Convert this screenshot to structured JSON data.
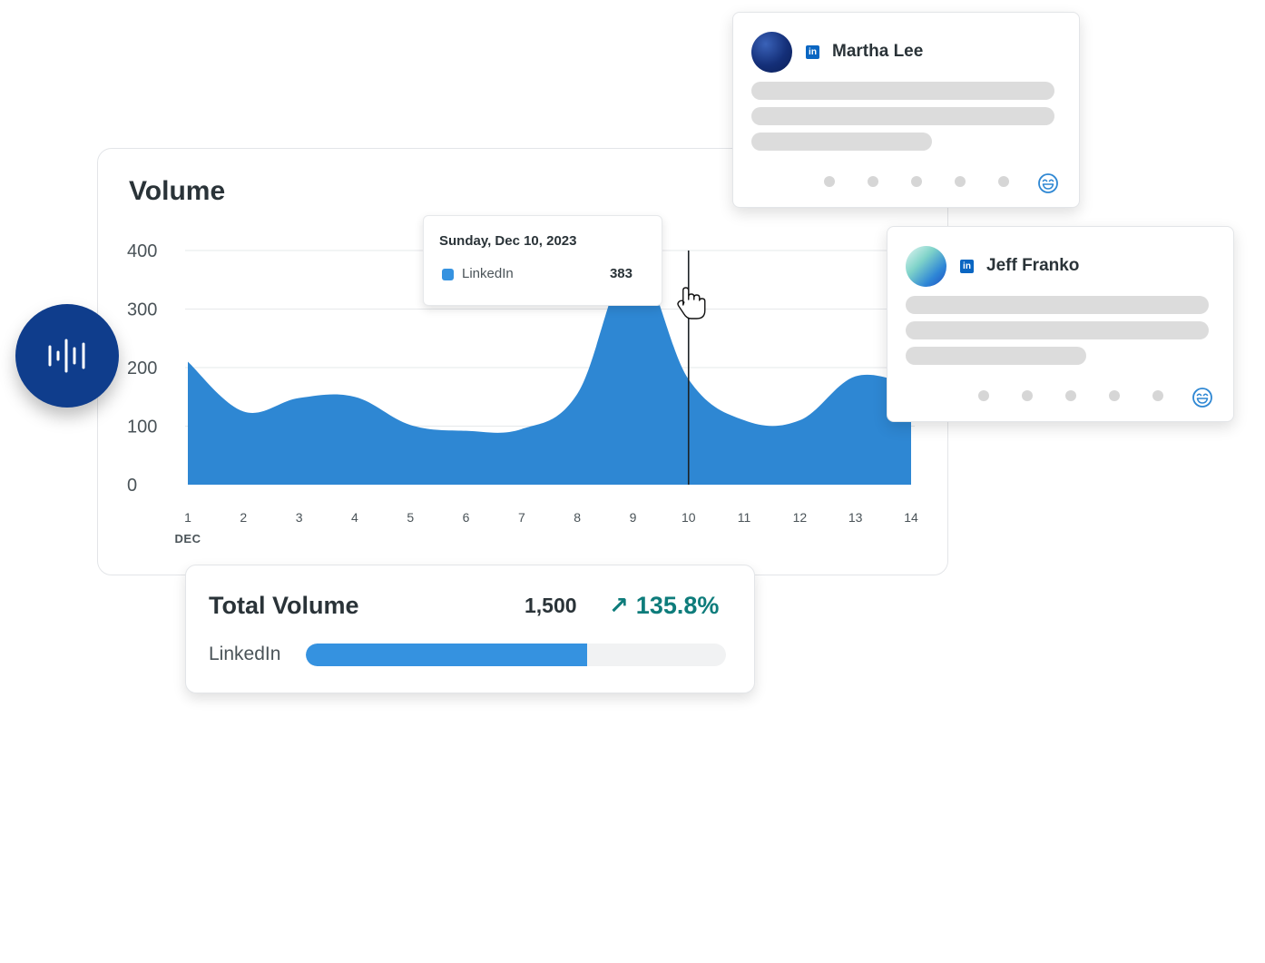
{
  "volume_card": {
    "title": "Volume"
  },
  "chart_data": {
    "type": "area",
    "title": "Volume",
    "x": [
      1,
      2,
      3,
      4,
      5,
      6,
      7,
      8,
      9,
      10,
      11,
      12,
      13,
      14
    ],
    "x_tick_labels": [
      "1",
      "2",
      "3",
      "4",
      "5",
      "6",
      "7",
      "8",
      "9",
      "10",
      "11",
      "12",
      "13",
      "14"
    ],
    "x_month_label": "DEC",
    "y_tick_labels": [
      "400",
      "300",
      "200",
      "100",
      "0"
    ],
    "ylim": [
      0,
      400
    ],
    "grid": true,
    "series": [
      {
        "name": "LinkedIn",
        "color": "#2e87d3",
        "values": [
          210,
          125,
          148,
          150,
          102,
          92,
          95,
          155,
          383,
          180,
          110,
          110,
          185,
          170
        ]
      }
    ],
    "highlight_x": 10
  },
  "tooltip": {
    "date": "Sunday, Dec 10, 2023",
    "series": "LinkedIn",
    "value": "383",
    "swatch_color": "#3592e0"
  },
  "audio_badge": {
    "icon": "audio-waveform-icon",
    "color": "#0f3d8c"
  },
  "total_volume": {
    "title": "Total Volume",
    "value": "1,500",
    "change": "135.8%",
    "change_icon": "↗",
    "change_color": "#0e7c7b",
    "breakdown_label": "LinkedIn",
    "breakdown_fraction": 0.67
  },
  "profiles": [
    {
      "name": "Martha Lee",
      "network_icon": "linkedin-icon",
      "reaction_icon": "smile-icon"
    },
    {
      "name": "Jeff Franko",
      "network_icon": "linkedin-icon",
      "reaction_icon": "smile-icon"
    }
  ],
  "linkedin_glyph": "in"
}
